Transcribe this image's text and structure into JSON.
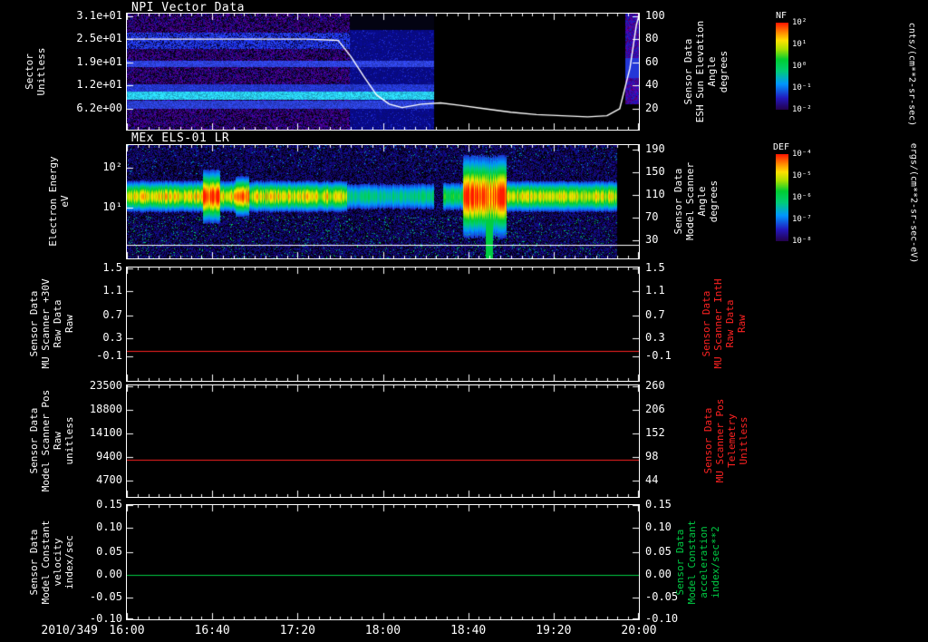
{
  "page": {
    "background": "#000000",
    "text_color": "#ffffff"
  },
  "chart_data": {
    "type": "multi-panel-time-series",
    "x_axis": {
      "date": "2010/349",
      "ticks": [
        "16:00",
        "16:40",
        "17:20",
        "18:00",
        "18:40",
        "19:20",
        "20:00"
      ],
      "hours_range": [
        16,
        20
      ]
    },
    "panels": [
      {
        "id": "npi-vector-data",
        "type": "heatmap",
        "title": "NPI Vector Data",
        "y_left": {
          "label": "Sector\nUnitless",
          "ticks": [
            {
              "label": "3.1e+01",
              "frac": 0.02
            },
            {
              "label": "2.5e+01",
              "frac": 0.22
            },
            {
              "label": "1.9e+01",
              "frac": 0.42
            },
            {
              "label": "1.2e+01",
              "frac": 0.62
            },
            {
              "label": "6.2e+00",
              "frac": 0.82
            }
          ]
        },
        "y_right": {
          "label": "Sensor Data\nESH Sun Elevation\nAngle\ndegrees",
          "color": "#ffffff",
          "ticks": [
            {
              "label": "100",
              "frac": 0.02
            },
            {
              "label": "80",
              "frac": 0.22
            },
            {
              "label": "60",
              "frac": 0.42
            },
            {
              "label": "40",
              "frac": 0.62
            },
            {
              "label": "20",
              "frac": 0.82
            }
          ],
          "scale": {
            "v_top": 100,
            "f_top": 0.02,
            "v_bot": 20,
            "f_bot": 0.82
          }
        },
        "colorbar": {
          "title": "NF",
          "units": "cnts/(cm**2-sr-sec)",
          "ticks": [
            "10²",
            "10¹",
            "10⁰",
            "10⁻¹",
            "10⁻²"
          ]
        },
        "overlay_series": {
          "name": "ESH Sun Elevation Angle",
          "axis": "right",
          "color": "#ffffff",
          "points_hours_degrees": [
            [
              16.0,
              80
            ],
            [
              16.5,
              80
            ],
            [
              17.0,
              80
            ],
            [
              17.4,
              80
            ],
            [
              17.65,
              79
            ],
            [
              17.75,
              65
            ],
            [
              17.85,
              48
            ],
            [
              17.95,
              32
            ],
            [
              18.05,
              24
            ],
            [
              18.15,
              21
            ],
            [
              18.3,
              24
            ],
            [
              18.45,
              25
            ],
            [
              18.6,
              23
            ],
            [
              18.8,
              20
            ],
            [
              19.0,
              17
            ],
            [
              19.2,
              15
            ],
            [
              19.4,
              14
            ],
            [
              19.6,
              13
            ],
            [
              19.75,
              14
            ],
            [
              19.85,
              20
            ],
            [
              19.93,
              55
            ],
            [
              19.98,
              92
            ],
            [
              20.0,
              100
            ]
          ]
        },
        "heatmap": {
          "speckle_end_t": 0.435,
          "wash_end_t": 0.6,
          "right_patch_start_t": 0.972,
          "speckle_band": [
            0.16,
            0.3
          ],
          "stripes": [
            {
              "y0": 0.4,
              "y1": 0.455,
              "color": [
                45,
                65,
                220
              ]
            },
            {
              "y0": 0.605,
              "y1": 0.665,
              "color": [
                35,
                55,
                205
              ]
            },
            {
              "y0": 0.67,
              "y1": 0.735,
              "color": [
                40,
                200,
                240
              ]
            },
            {
              "y0": 0.745,
              "y1": 0.815,
              "color": [
                42,
                63,
                210
              ]
            }
          ]
        }
      },
      {
        "id": "mex-els-01-lr",
        "type": "heatmap",
        "title": "MEx ELS-01 LR",
        "y_left": {
          "label": "Electron Energy\neV",
          "ticks": [
            {
              "label": "10²",
              "frac": 0.2
            },
            {
              "label": "10¹",
              "frac": 0.55
            }
          ]
        },
        "y_right": {
          "label": "Sensor Data\nModel Scanner\nAngle\ndegrees",
          "color": "#ffffff",
          "ticks": [
            {
              "label": "190",
              "frac": 0.04
            },
            {
              "label": "150",
              "frac": 0.24
            },
            {
              "label": "110",
              "frac": 0.44
            },
            {
              "label": "70",
              "frac": 0.64
            },
            {
              "label": "30",
              "frac": 0.84
            }
          ]
        },
        "colorbar": {
          "title": "DEF",
          "units": "ergs/(cm**2-sr-sec-eV)",
          "ticks": [
            "10⁻⁴",
            "10⁻⁵",
            "10⁻⁶",
            "10⁻⁷",
            "10⁻⁸"
          ]
        },
        "hline": {
          "frac": 0.88,
          "color": "#ffffff"
        },
        "heatmap": {
          "data_end_t": 0.957,
          "band_center": 0.45,
          "band_halfwidth": 0.105,
          "segments": [
            {
              "t0": 0.0,
              "t1": 0.43,
              "i": 0.78
            },
            {
              "t0": 0.43,
              "t1": 0.6,
              "i": 0.45
            },
            {
              "t0": 0.6,
              "t1": 0.617,
              "i": 0.12
            },
            {
              "t0": 0.617,
              "t1": 0.655,
              "i": 0.55
            },
            {
              "t0": 0.655,
              "t1": 0.74,
              "i": 1.0,
              "hw": 0.26
            },
            {
              "t0": 0.74,
              "t1": 0.957,
              "i": 0.75
            }
          ],
          "hot_spots": [
            {
              "t0": 0.148,
              "t1": 0.182,
              "boost": 0.22,
              "hw": 0.17
            },
            {
              "t0": 0.212,
              "t1": 0.238,
              "boost": 0.16,
              "hw": 0.13
            }
          ],
          "green_streak_t": [
            0.7,
            0.714
          ]
        }
      },
      {
        "id": "mu-scanner-plus30v",
        "type": "line",
        "y_left": {
          "label": "Sensor Data\nMU Scanner +30V\nRaw Data\nRaw",
          "ticks": [
            {
              "label": "1.5",
              "frac": 0.01
            },
            {
              "label": "1.1",
              "frac": 0.21
            },
            {
              "label": "0.7",
              "frac": 0.42
            },
            {
              "label": "0.3",
              "frac": 0.62
            },
            {
              "label": "-0.1",
              "frac": 0.78
            }
          ]
        },
        "y_right": {
          "label": "Sensor Data\nMU Scanner IntH\nRaw Data\nRaw",
          "color": "#ff2222",
          "ticks": [
            {
              "label": "1.5",
              "frac": 0.01
            },
            {
              "label": "1.1",
              "frac": 0.21
            },
            {
              "label": "0.7",
              "frac": 0.42
            },
            {
              "label": "0.3",
              "frac": 0.62
            },
            {
              "label": "-0.1",
              "frac": 0.78
            }
          ]
        },
        "series": {
          "name": "MU Scanner +30V Raw",
          "color": "#ff2222",
          "value": 0.0,
          "frac": 0.735
        }
      },
      {
        "id": "model-scanner-pos",
        "type": "line",
        "y_left": {
          "label": "Sensor Data\nModel Scanner Pos\nRaw\nunitless",
          "ticks": [
            {
              "label": "23500",
              "frac": 0.01
            },
            {
              "label": "18800",
              "frac": 0.22
            },
            {
              "label": "14100",
              "frac": 0.43
            },
            {
              "label": "9400",
              "frac": 0.64
            },
            {
              "label": "4700",
              "frac": 0.85
            }
          ]
        },
        "y_right": {
          "label": "Sensor Data\nMU Scanner Pos\nTelemetry\nUnitless",
          "color": "#ff2222",
          "ticks": [
            {
              "label": "260",
              "frac": 0.01
            },
            {
              "label": "206",
              "frac": 0.22
            },
            {
              "label": "152",
              "frac": 0.43
            },
            {
              "label": "98",
              "frac": 0.64
            },
            {
              "label": "44",
              "frac": 0.85
            }
          ]
        },
        "series": {
          "name": "Model Scanner Pos Raw",
          "color": "#ff2222",
          "value": 8800,
          "frac": 0.665
        }
      },
      {
        "id": "model-constant-velocity",
        "type": "line",
        "y_left": {
          "label": "Sensor Data\nModel Constant\nvelocity\nindex/sec",
          "ticks": [
            {
              "label": "0.15",
              "frac": 0.0
            },
            {
              "label": "0.10",
              "frac": 0.2
            },
            {
              "label": "0.05",
              "frac": 0.41
            },
            {
              "label": "0.00",
              "frac": 0.61
            },
            {
              "label": "-0.05",
              "frac": 0.81
            },
            {
              "label": "-0.10",
              "frac": 1.0
            }
          ]
        },
        "y_right": {
          "label": "Sensor Data\nModel Constant\nacceleration\nindex/sec**2",
          "color": "#00cc44",
          "ticks": [
            {
              "label": "0.15",
              "frac": 0.0
            },
            {
              "label": "0.10",
              "frac": 0.2
            },
            {
              "label": "0.05",
              "frac": 0.41
            },
            {
              "label": "0.00",
              "frac": 0.61
            },
            {
              "label": "-0.05",
              "frac": 0.81
            },
            {
              "label": "-0.10",
              "frac": 1.0
            }
          ]
        },
        "series": {
          "name": "Model Constant velocity",
          "color": "#00cc44",
          "value": 0.0,
          "frac": 0.61
        }
      }
    ]
  }
}
